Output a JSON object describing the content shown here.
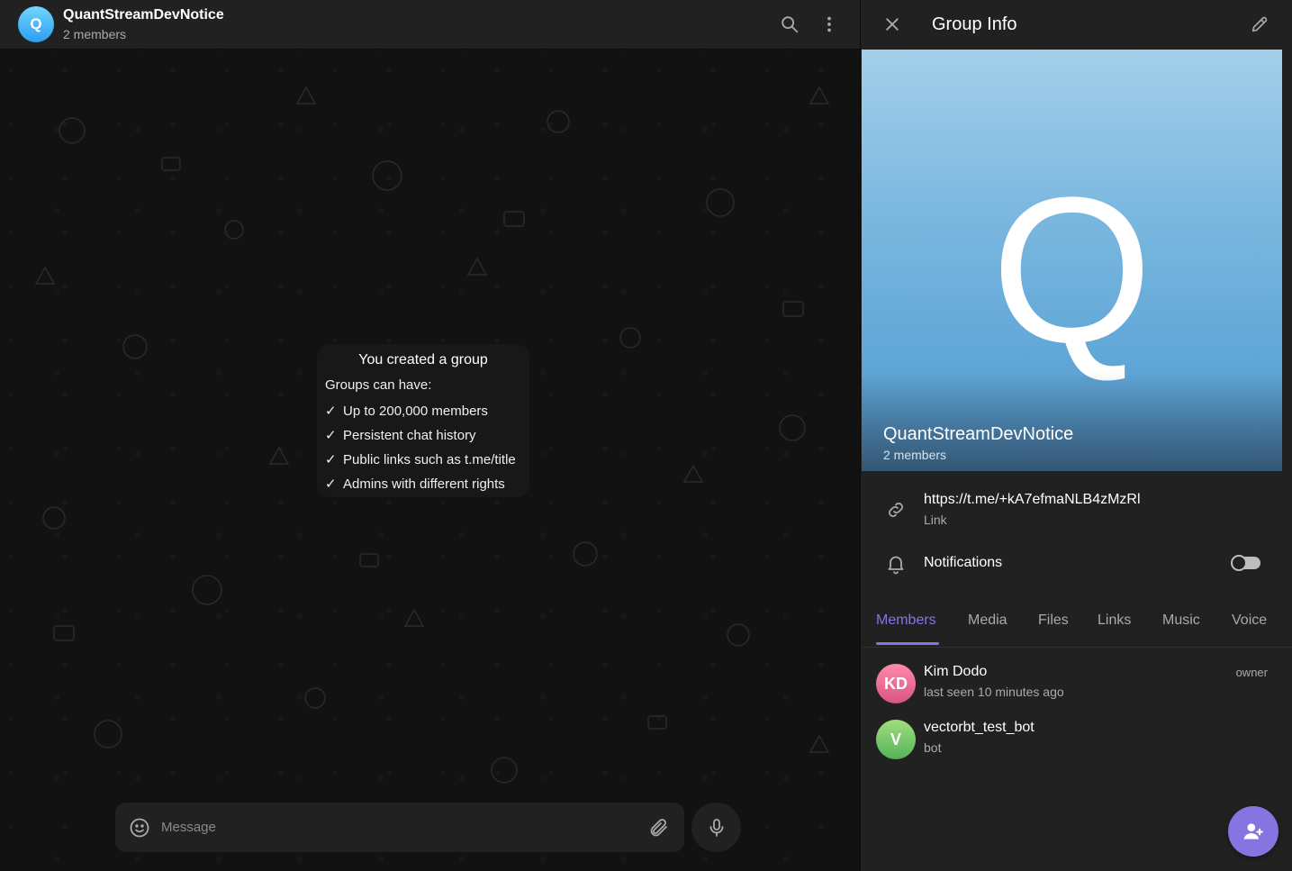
{
  "chat_header": {
    "avatar_letter": "Q",
    "title": "QuantStreamDevNotice",
    "subtitle": "2 members",
    "search_icon": "search-icon",
    "more_icon": "more-vertical-icon"
  },
  "service_message": {
    "title": "You created a group",
    "intro": "Groups can have:",
    "items": [
      "Up to 200,000 members",
      "Persistent chat history",
      "Public links such as t.me/title",
      "Admins with different rights"
    ],
    "check_glyph": "✓"
  },
  "composer": {
    "placeholder": "Message",
    "emoji_icon": "smile-icon",
    "attach_icon": "paperclip-icon",
    "mic_icon": "microphone-icon"
  },
  "panel": {
    "title": "Group Info",
    "close_icon": "close-icon",
    "edit_icon": "pencil-icon",
    "cover": {
      "letter": "Q",
      "name": "QuantStreamDevNotice",
      "subtitle": "2 members"
    },
    "link": {
      "value": "https://t.me/+kA7efmaNLB4zMzRl",
      "label": "Link",
      "icon": "link-icon"
    },
    "notifications": {
      "label": "Notifications",
      "icon": "bell-icon",
      "enabled": false
    },
    "tabs": [
      "Members",
      "Media",
      "Files",
      "Links",
      "Music",
      "Voice"
    ],
    "active_tab": "Members",
    "members": [
      {
        "initials": "KD",
        "name": "Kim Dodo",
        "status": "last seen 10 minutes ago",
        "role": "owner",
        "color": "#e86b9a"
      },
      {
        "initials": "V",
        "name": "vectorbt_test_bot",
        "status": "bot",
        "role": "",
        "color": "#6cc46b"
      }
    ],
    "fab_icon": "add-member-icon"
  },
  "colors": {
    "accent": "#8774e1",
    "panel_bg": "#212121",
    "chat_bg": "#121212",
    "avatar_gradient_top": "#72d5fd",
    "avatar_gradient_bottom": "#2a9ef1"
  }
}
